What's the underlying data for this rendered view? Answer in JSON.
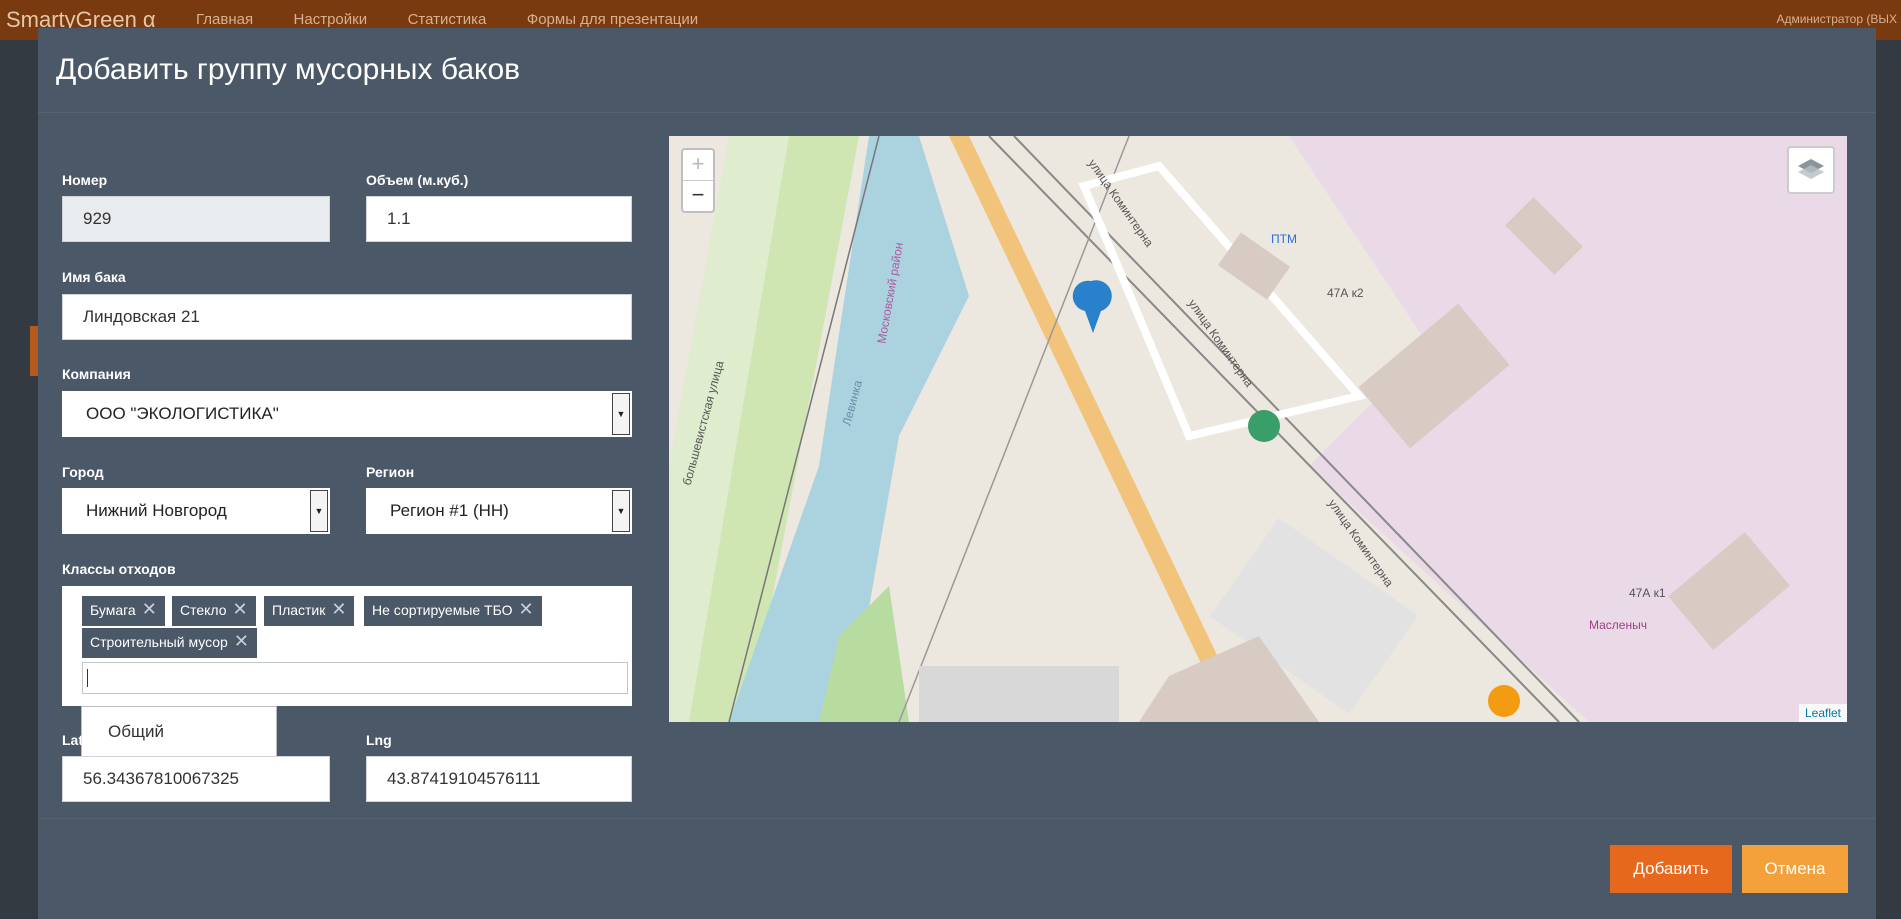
{
  "app": {
    "brand": "SmartyGreen α",
    "nav": [
      "Главная",
      "Настройки",
      "Статистика",
      "Формы для презентации"
    ],
    "user": "Администратор (ВЫХ"
  },
  "modal": {
    "title": "Добавить группу мусорных баков",
    "fields": {
      "number_label": "Номер",
      "number_value": "929",
      "volume_label": "Объем (м.куб.)",
      "volume_value": "1.1",
      "name_label": "Имя бака",
      "name_value": "Линдовская 21",
      "company_label": "Компания",
      "company_value": "ООО \"ЭКОЛОГИСТИКА\"",
      "city_label": "Город",
      "city_value": "Нижний Новгород",
      "region_label": "Регион",
      "region_value": "Регион #1 (НН)",
      "waste_label": "Классы отходов",
      "waste_tags": [
        "Бумага",
        "Стекло",
        "Пластик",
        "Не сортируемые ТБО",
        "Строительный мусор"
      ],
      "waste_dropdown_option": "Общий",
      "lat_label": "Lat",
      "lat_value": "56.34367810067325",
      "lng_label": "Lng",
      "lng_value": "43.87419104576111"
    },
    "map": {
      "zoom_in": "+",
      "zoom_out": "−",
      "attribution": "Leaflet",
      "labels": {
        "street1": "улица Коминтерна",
        "street2": "улица Коминтерна",
        "street3": "улица Коминтерна",
        "river": "Левинка",
        "district": "Московский район",
        "street_left": "большевистская улица",
        "ptm": "ПТМ",
        "bld1": "47А к2",
        "bld2": "47А к1",
        "shop": "Масленыч"
      }
    },
    "buttons": {
      "add": "Добавить",
      "cancel": "Отмена"
    }
  },
  "colors": {
    "accent": "#e5681d",
    "cancel": "#f4a13c",
    "modal_bg": "#4b5868",
    "topbar": "#7a3a10"
  }
}
